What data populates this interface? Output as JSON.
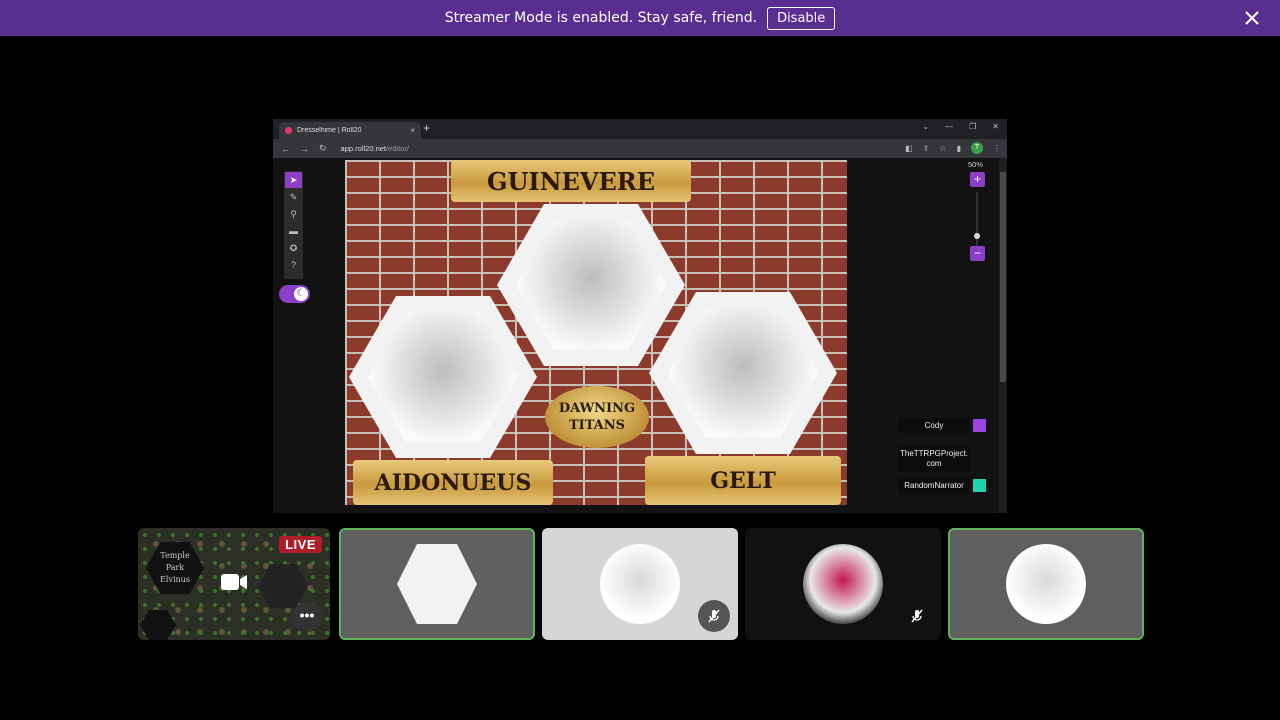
{
  "banner": {
    "text": "Streamer Mode is enabled. Stay safe, friend.",
    "disable_label": "Disable",
    "bg_color": "#5a2d91"
  },
  "browser": {
    "tab_title": "Dresselhime | Roll20",
    "tab_close": "×",
    "new_tab": "+",
    "url_host": "app.roll20.net",
    "url_path": "/editor/",
    "profile_initial": "T"
  },
  "editor": {
    "zoom_label": "50%",
    "zoom_in": "+",
    "zoom_out": "−",
    "board": {
      "title_top": "GUINEVERE",
      "title_left": "AIDONUEUS",
      "title_right": "GELT",
      "seal_line1": "DAWNING",
      "seal_line2": "TITANS"
    },
    "players": [
      {
        "name": "Cody",
        "color": "#9b45e4"
      },
      {
        "name": "TheTTRPGProject.\ncom",
        "color": ""
      },
      {
        "name": "RandomNarrator",
        "color": "#1ed4b0"
      }
    ]
  },
  "participants": {
    "preview": {
      "live_label": "LIVE",
      "hex_label": "Temple\nPark\nElvinus",
      "more_label": "•••"
    },
    "tiles": [
      {
        "bg": "#5f5f5f",
        "speaking": true
      },
      {
        "bg": "#d6d6d6",
        "speaking": false,
        "muted": true
      },
      {
        "bg": "#111111",
        "speaking": false,
        "muted": true
      },
      {
        "bg": "#5f5f5f",
        "speaking": true
      }
    ]
  },
  "icons": {
    "close": "close-icon",
    "camera": "camera-icon",
    "mute": "mic-off-icon",
    "more": "more-icon"
  }
}
